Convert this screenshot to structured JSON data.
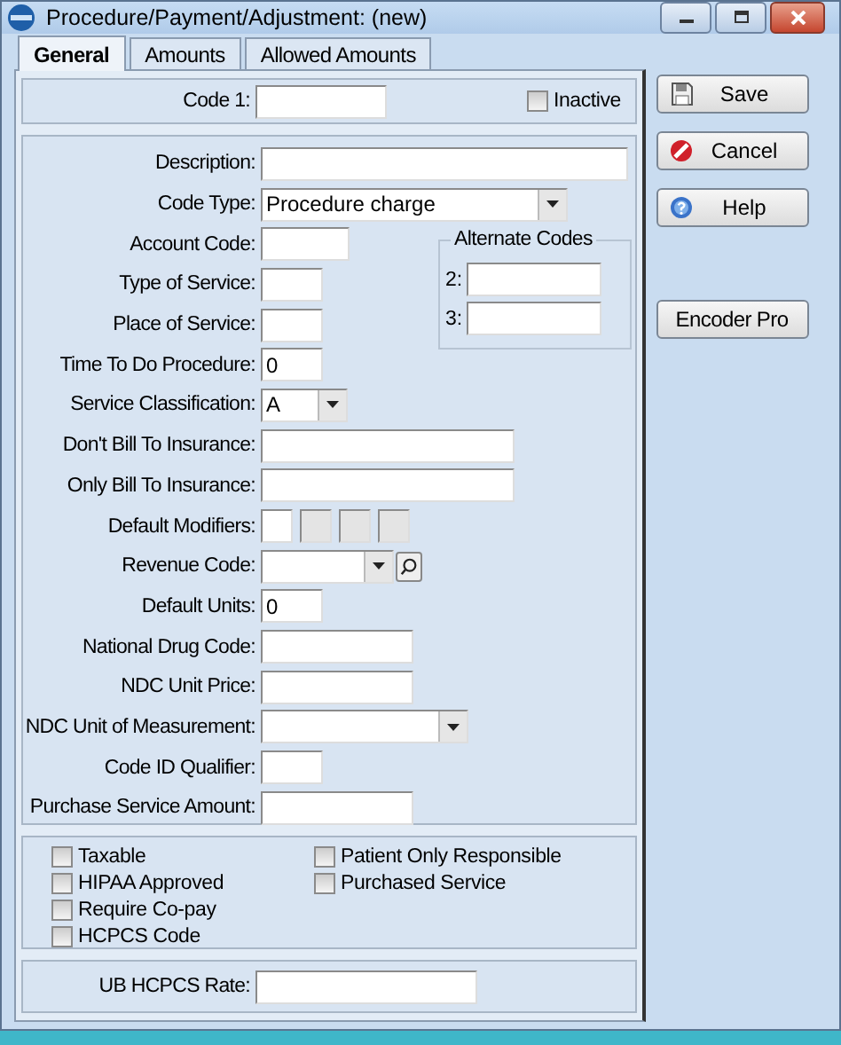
{
  "window": {
    "title": "Procedure/Payment/Adjustment: (new)"
  },
  "tabs": [
    {
      "label": "General",
      "selected": true
    },
    {
      "label": "Amounts",
      "selected": false
    },
    {
      "label": "Allowed Amounts",
      "selected": false
    }
  ],
  "header": {
    "code_label": "Code 1:",
    "inactive": {
      "label": "Inactive",
      "checked": false
    }
  },
  "fields": [
    {
      "kind": "text",
      "label": "Description:"
    },
    {
      "kind": "combo",
      "label": "Code Type:",
      "value": "Procedure charge"
    },
    {
      "kind": "text",
      "label": "Account Code:"
    },
    {
      "kind": "text",
      "label": "Type of Service:"
    },
    {
      "kind": "text",
      "label": "Place of Service:"
    },
    {
      "kind": "text",
      "label": "Time To Do Procedure:",
      "value": "0"
    },
    {
      "kind": "combo",
      "label": "Service Classification:",
      "value": "A"
    },
    {
      "kind": "text",
      "label": "Don't Bill To Insurance:"
    },
    {
      "kind": "text",
      "label": "Only Bill To Insurance:"
    },
    {
      "kind": "modifiers",
      "label": "Default Modifiers:",
      "boxes": [
        {
          "disabled": false
        },
        {
          "disabled": true
        },
        {
          "disabled": true
        },
        {
          "disabled": true
        }
      ]
    },
    {
      "kind": "lookup",
      "label": "Revenue Code:"
    },
    {
      "kind": "text",
      "label": "Default Units:",
      "value": "0"
    },
    {
      "kind": "text",
      "label": "National Drug Code:"
    },
    {
      "kind": "text",
      "label": "NDC Unit Price:"
    },
    {
      "kind": "combo",
      "label": "NDC Unit of Measurement:"
    },
    {
      "kind": "text",
      "label": "Code ID Qualifier:"
    },
    {
      "kind": "text",
      "label": "Purchase Service Amount:"
    }
  ],
  "alternate_codes": {
    "title": "Alternate Codes",
    "codes": [
      {
        "label": "2:"
      },
      {
        "label": "3:"
      }
    ]
  },
  "options": [
    {
      "label": "Taxable",
      "checked": false
    },
    {
      "label": "HIPAA Approved",
      "checked": false
    },
    {
      "label": "Require Co-pay",
      "checked": false
    },
    {
      "label": "HCPCS Code",
      "checked": false
    },
    {
      "label": "Patient Only Responsible",
      "checked": false
    },
    {
      "label": "Purchased Service",
      "checked": false
    }
  ],
  "ub_rate": {
    "label": "UB HCPCS Rate:"
  },
  "buttons": [
    {
      "label": "Save"
    },
    {
      "label": "Cancel"
    },
    {
      "label": "Help"
    },
    {
      "label": "Encoder Pro"
    }
  ]
}
